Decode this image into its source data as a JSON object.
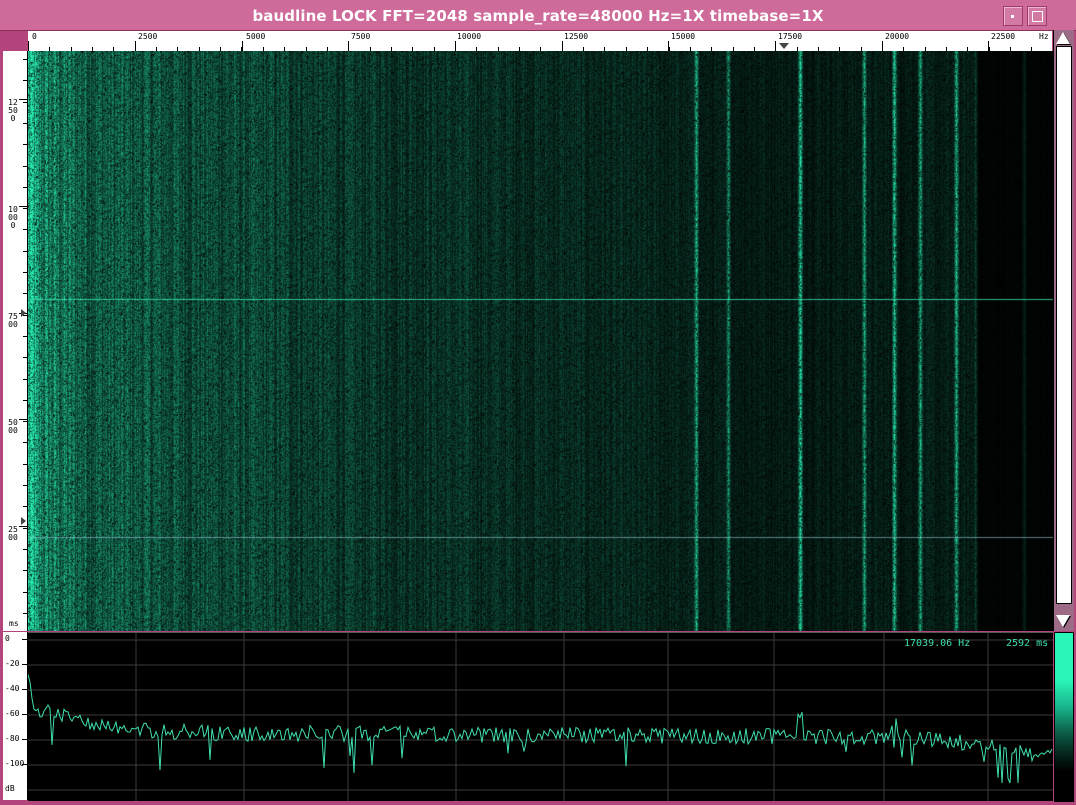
{
  "window": {
    "title": "baudline  LOCK FFT=2048 sample_rate=48000 Hz=1X timebase=1X"
  },
  "freq_axis": {
    "unit": "Hz",
    "ticks": [
      "0",
      "2500",
      "5000",
      "7500",
      "10000",
      "12500",
      "15000",
      "17500",
      "20000",
      "22500"
    ]
  },
  "time_axis": {
    "unit": "ms",
    "ticks": [
      "12500",
      "10000",
      "7500",
      "5000",
      "2500"
    ]
  },
  "db_axis": {
    "unit": "dB",
    "ticks": [
      "0",
      "-20",
      "-40",
      "-60",
      "-80",
      "-100"
    ]
  },
  "readout": {
    "frequency": "17039.06 Hz",
    "time": "2592 ms"
  },
  "colors": {
    "signal": "#29f5b8",
    "background": "#000000",
    "frame": "#b4457c",
    "titlebar": "#cf6b9a"
  },
  "icons": {
    "minimize": "minimize-icon",
    "maximize": "maximize-icon",
    "scroll_up": "arrow-up-icon",
    "scroll_down": "arrow-down-icon"
  }
}
